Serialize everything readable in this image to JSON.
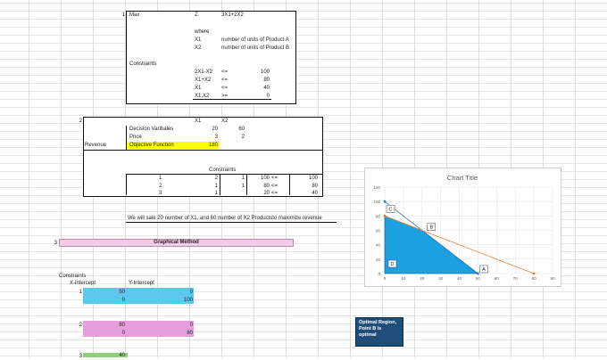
{
  "model": {
    "row_number": "1",
    "max_label": "Max",
    "z_label": "Z",
    "objective": "3X1+2X2",
    "where_label": "where",
    "variables": [
      {
        "name": "X1",
        "desc": "number of units of Product A"
      },
      {
        "name": "X2",
        "desc": "number of units of Product B"
      }
    ],
    "constraints_label": "Constraints",
    "constraints": [
      {
        "lhs": "2X1-X2",
        "op": "<=",
        "rhs": "100"
      },
      {
        "lhs": "X1+X2",
        "op": "<=",
        "rhs": "80"
      },
      {
        "lhs": "X1",
        "op": "<=",
        "rhs": "40"
      },
      {
        "lhs": "X1,X2",
        "op": ">=",
        "rhs": "0"
      }
    ]
  },
  "solver": {
    "row_number": "2",
    "col_x1": "X1",
    "col_x2": "X2",
    "decision_label": "Decision Varibales",
    "decision_x1": "20",
    "decision_x2": "60",
    "price_label": "Price",
    "price_x1": "3",
    "price_x2": "2",
    "revenue_label": "Revenue",
    "objective_label": "Objective Function",
    "objective_value": "180",
    "constraints_header": "Constraints",
    "constraints": [
      {
        "idx": "1",
        "a": "2",
        "b": "1",
        "lhs": "100",
        "op": "<=",
        "rhs": "100"
      },
      {
        "idx": "2",
        "a": "1",
        "b": "1",
        "lhs": "80",
        "op": "<=",
        "rhs": "80"
      },
      {
        "idx": "3",
        "a": "1",
        "b": "",
        "lhs": "20",
        "op": "<=",
        "rhs": "40"
      }
    ],
    "conclusion": "We will sale 20 number of X1, and 60 number of X2 Productsto maximize revenue"
  },
  "graphical": {
    "row_number": "3",
    "title": "Graphical Method",
    "constraints_label": "Constraints",
    "x_intercept_label": "X-intercept",
    "y_intercept_label": "Y-Intercept",
    "groups": [
      {
        "idx": "1",
        "color": "#5bc8ee",
        "rows": [
          [
            "50",
            "0"
          ],
          [
            "0",
            "100"
          ]
        ]
      },
      {
        "idx": "2",
        "color": "#e59fdf",
        "rows": [
          [
            "80",
            "0"
          ],
          [
            "0",
            "80"
          ]
        ]
      },
      {
        "idx": "3",
        "color": "#8fd17a",
        "rows": [
          [
            "40",
            ""
          ]
        ]
      }
    ]
  },
  "chart_data": {
    "type": "area",
    "title": "Chart Title",
    "xlim": [
      0,
      90
    ],
    "ylim": [
      0,
      120
    ],
    "x_ticks": [
      0,
      10,
      20,
      30,
      40,
      50,
      60,
      70,
      80,
      90
    ],
    "y_ticks": [
      0,
      20,
      40,
      60,
      80,
      100,
      120
    ],
    "grid": true,
    "feasible_region": [
      [
        0,
        0
      ],
      [
        0,
        80
      ],
      [
        20,
        60
      ],
      [
        50,
        0
      ]
    ],
    "series": [
      {
        "name": "",
        "color": "#2e75b6",
        "points": [
          [
            0,
            100
          ],
          [
            50,
            0
          ]
        ]
      },
      {
        "name": "",
        "color": "#ed7d31",
        "points": [
          [
            0,
            80
          ],
          [
            80,
            0
          ]
        ]
      }
    ],
    "point_labels": [
      {
        "label": "C",
        "x": 0,
        "y": 80
      },
      {
        "label": "B",
        "x": 20,
        "y": 60
      },
      {
        "label": "A",
        "x": 50,
        "y": 0
      },
      {
        "label": "D",
        "x": 0,
        "y": 0
      }
    ],
    "fill_color": "#1ba1e2"
  },
  "callout": "Optimal Region, Point B is optimal"
}
